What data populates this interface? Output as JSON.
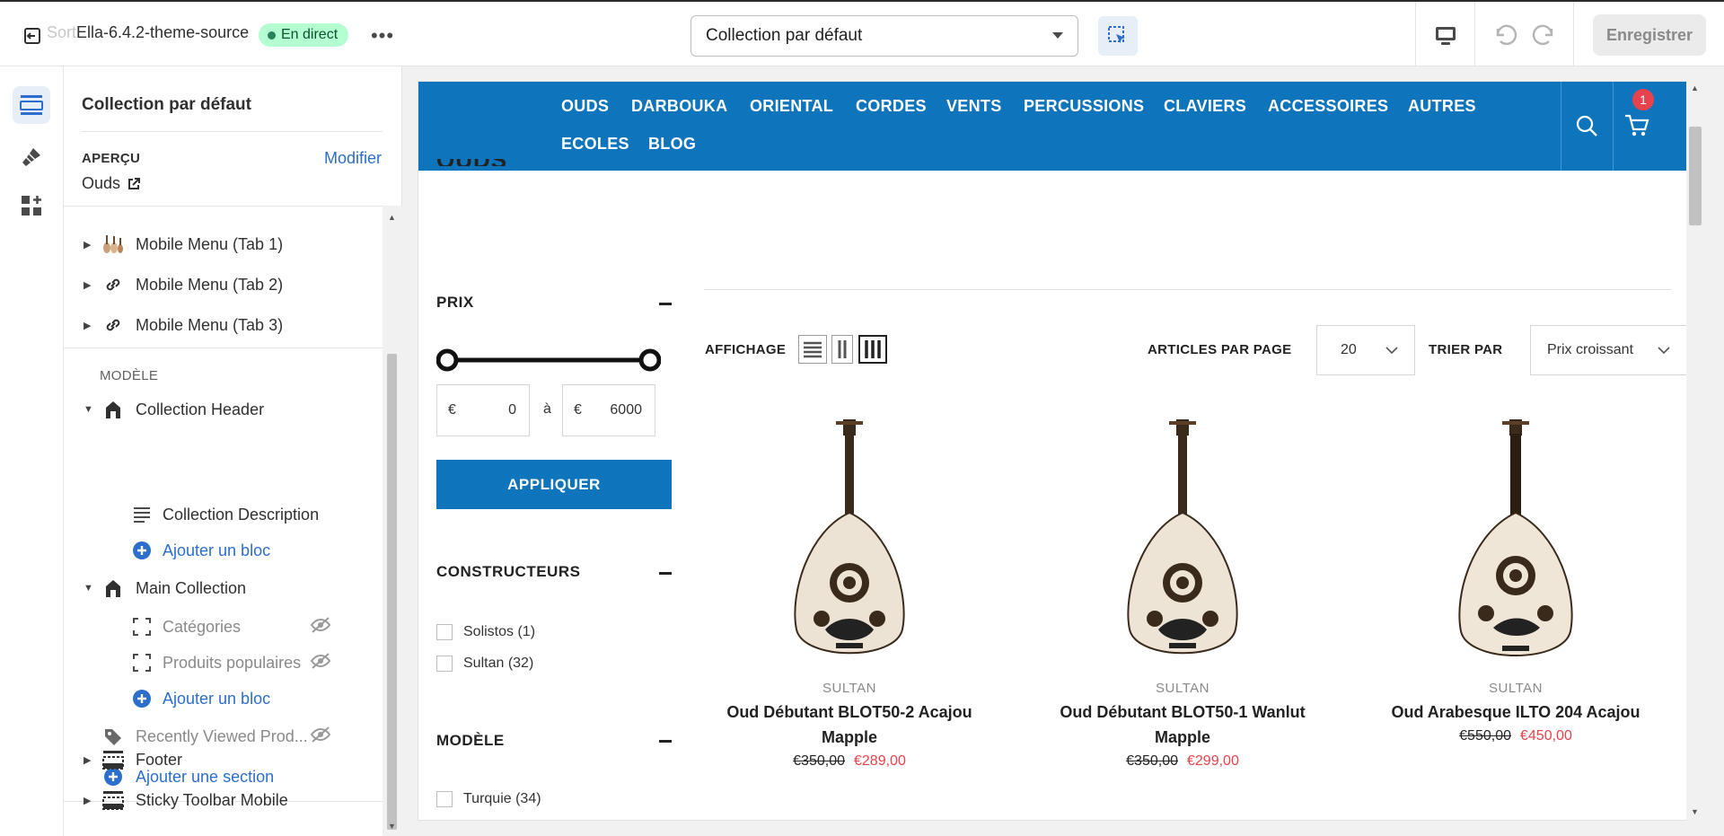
{
  "topbar": {
    "theme_name_faded": "Sort",
    "theme_name": "Ella-6.4.2-theme-source",
    "live_badge": "En direct",
    "more_label": "•••",
    "template_select": "Collection par défaut",
    "save_label": "Enregistrer"
  },
  "sidebar": {
    "title": "Collection par défaut",
    "preview_label": "APERÇU",
    "preview_edit": "Modifier",
    "preview_value": "Ouds",
    "header_items": [
      {
        "label": "Mobile Menu (Tab 1)",
        "icon": "instruments-image-icon"
      },
      {
        "label": "Mobile Menu (Tab 2)",
        "icon": "link-icon"
      },
      {
        "label": "Mobile Menu (Tab 3)",
        "icon": "link-icon"
      }
    ],
    "template_label": "MODÈLE",
    "collection_header": "Collection Header",
    "collection_description": "Collection Description",
    "add_block_1": "Ajouter un bloc",
    "main_collection": "Main Collection",
    "categories": "Catégories",
    "popular_products": "Produits populaires",
    "add_block_2": "Ajouter un bloc",
    "recently_viewed": "Recently Viewed Prod...",
    "add_section": "Ajouter une section",
    "footer": "Footer",
    "sticky_toolbar": "Sticky Toolbar Mobile"
  },
  "store": {
    "nav": [
      "OUDS",
      "DARBOUKA",
      "ORIENTAL",
      "CORDES",
      "VENTS",
      "PERCUSSIONS",
      "CLAVIERS",
      "ACCESSOIRES",
      "AUTRES",
      "ECOLES",
      "BLOG"
    ],
    "cart_count": "1",
    "page_heading": "OUDS",
    "filters": {
      "price_title": "PRIX",
      "currency": "€",
      "price_min": "0",
      "price_to": "à",
      "price_max": "6000",
      "apply": "APPLIQUER",
      "brands_title": "CONSTRUCTEURS",
      "brands": [
        "Solistos (1)",
        "Sultan (32)"
      ],
      "model_title": "MODÈLE",
      "models": [
        "Turquie (34)"
      ]
    },
    "toolbar": {
      "display_label": "AFFICHAGE",
      "per_page_label": "ARTICLES PAR PAGE",
      "per_page_value": "20",
      "sort_label": "TRIER PAR",
      "sort_value": "Prix croissant"
    },
    "products": [
      {
        "vendor": "SULTAN",
        "name": "Oud Débutant BLOT50-2 Acajou Mapple",
        "old_price": "€350,00",
        "price": "€289,00"
      },
      {
        "vendor": "SULTAN",
        "name": "Oud Débutant BLOT50-1 Wanlut Mapple",
        "old_price": "€350,00",
        "price": "€299,00"
      },
      {
        "vendor": "SULTAN",
        "name": "Oud Arabesque ILTO 204 Acajou",
        "old_price": "€550,00",
        "price": "€450,00"
      }
    ]
  },
  "colors": {
    "brand": "#0e75bd",
    "sale": "#e8434c",
    "link": "#2c6ecb",
    "live": "#b4fed2"
  }
}
